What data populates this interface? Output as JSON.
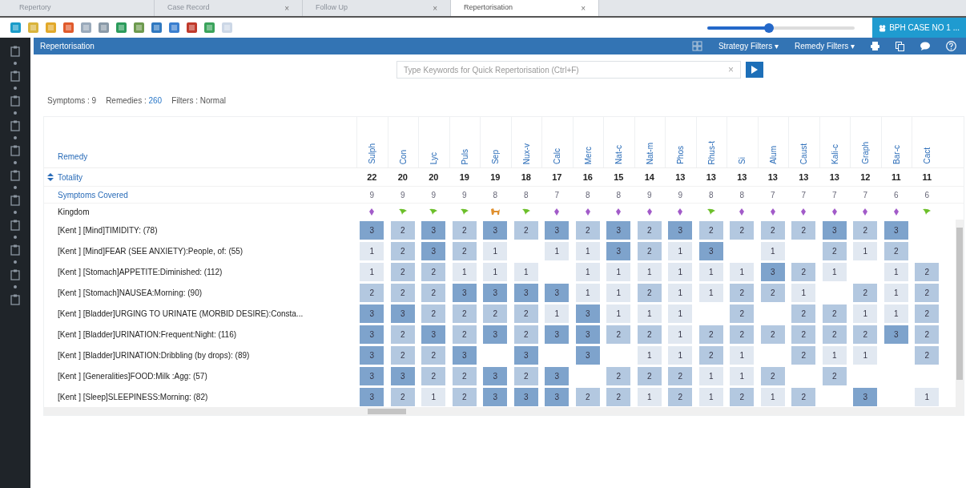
{
  "tabs": [
    {
      "label": "Repertory",
      "selected": false
    },
    {
      "label": "Case Record",
      "selected": false,
      "close": "×"
    },
    {
      "label": "Follow Up",
      "selected": false,
      "close": "×"
    },
    {
      "label": "Repertorisation",
      "selected": true,
      "close": "×"
    }
  ],
  "zoom_slider": {
    "level": 0.42
  },
  "case_button": {
    "label": "BPH CASE NO 1 ..."
  },
  "panel": {
    "title": "Repertorisation",
    "menus": [
      {
        "label": "Strategy Filters",
        "caret": "▾"
      },
      {
        "label": "Remedy Filters",
        "caret": "▾"
      }
    ]
  },
  "search": {
    "placeholder": "Type Keywords for Quick Repertorisation (Ctrl+F)",
    "clear": "×"
  },
  "stats": [
    {
      "label": "Symptoms :",
      "value": "9",
      "highlight": false
    },
    {
      "label": "Remedies :",
      "value": "260",
      "highlight": true
    },
    {
      "label": "Filters :",
      "value": "Normal",
      "highlight": false
    }
  ],
  "row_headers": {
    "remedy": "Remedy",
    "totality": "Totality",
    "covered": "Symptoms Covered",
    "kingdom": "Kingdom"
  },
  "remedies": [
    {
      "name": "Sulph",
      "totality": "22",
      "covered": "9",
      "kind": "mineral"
    },
    {
      "name": "Con",
      "totality": "20",
      "covered": "9",
      "kind": "plant"
    },
    {
      "name": "Lyc",
      "totality": "20",
      "covered": "9",
      "kind": "plant"
    },
    {
      "name": "Puls",
      "totality": "19",
      "covered": "9",
      "kind": "plant"
    },
    {
      "name": "Sep",
      "totality": "19",
      "covered": "8",
      "kind": "animal"
    },
    {
      "name": "Nux-v",
      "totality": "18",
      "covered": "8",
      "kind": "plant"
    },
    {
      "name": "Calc",
      "totality": "17",
      "covered": "7",
      "kind": "mineral"
    },
    {
      "name": "Merc",
      "totality": "16",
      "covered": "8",
      "kind": "mineral"
    },
    {
      "name": "Nat-c",
      "totality": "15",
      "covered": "8",
      "kind": "mineral"
    },
    {
      "name": "Nat-m",
      "totality": "14",
      "covered": "9",
      "kind": "mineral"
    },
    {
      "name": "Phos",
      "totality": "13",
      "covered": "9",
      "kind": "mineral"
    },
    {
      "name": "Rhus-t",
      "totality": "13",
      "covered": "8",
      "kind": "plant"
    },
    {
      "name": "Si",
      "totality": "13",
      "covered": "8",
      "kind": "mineral"
    },
    {
      "name": "Alum",
      "totality": "13",
      "covered": "7",
      "kind": "mineral"
    },
    {
      "name": "Caust",
      "totality": "13",
      "covered": "7",
      "kind": "mineral"
    },
    {
      "name": "Kali-c",
      "totality": "13",
      "covered": "7",
      "kind": "mineral"
    },
    {
      "name": "Graph",
      "totality": "12",
      "covered": "7",
      "kind": "mineral"
    },
    {
      "name": "Bar-c",
      "totality": "11",
      "covered": "6",
      "kind": "mineral"
    },
    {
      "name": "Cact",
      "totality": "11",
      "covered": "6",
      "kind": "plant"
    }
  ],
  "symptoms": [
    {
      "label": "[Kent ] [Mind]TIMIDITY: (78)",
      "cells": [
        {
          "grade": "3"
        },
        {
          "grade": "2"
        },
        {
          "grade": "3"
        },
        {
          "grade": "2"
        },
        {
          "grade": "3"
        },
        {
          "grade": "2"
        },
        {
          "grade": "3"
        },
        {
          "grade": "2"
        },
        {
          "grade": "3"
        },
        {
          "grade": "2"
        },
        {
          "grade": "3"
        },
        {
          "grade": "2"
        },
        {
          "grade": "2"
        },
        {
          "grade": "2"
        },
        {
          "grade": "2"
        },
        {
          "grade": "3"
        },
        {
          "grade": "2"
        },
        {
          "grade": "3"
        },
        {}
      ]
    },
    {
      "label": "[Kent ] [Mind]FEAR (SEE ANXIETY):People, of: (55)",
      "cells": [
        {
          "grade": "1"
        },
        {
          "grade": "2"
        },
        {
          "grade": "3"
        },
        {
          "grade": "2"
        },
        {
          "grade": "1"
        },
        {},
        {
          "grade": "1"
        },
        {
          "grade": "1"
        },
        {
          "grade": "3"
        },
        {
          "grade": "2"
        },
        {
          "grade": "1"
        },
        {
          "grade": "3"
        },
        {},
        {
          "grade": "1"
        },
        {},
        {
          "grade": "2"
        },
        {
          "grade": "1"
        },
        {
          "grade": "2"
        },
        {}
      ]
    },
    {
      "label": "[Kent ] [Stomach]APPETITE:Diminished: (112)",
      "cells": [
        {
          "grade": "1"
        },
        {
          "grade": "2"
        },
        {
          "grade": "2"
        },
        {
          "grade": "1"
        },
        {
          "grade": "1"
        },
        {
          "grade": "1"
        },
        {},
        {
          "grade": "1"
        },
        {
          "grade": "1"
        },
        {
          "grade": "1"
        },
        {
          "grade": "1"
        },
        {
          "grade": "1"
        },
        {
          "grade": "1"
        },
        {
          "grade": "3"
        },
        {
          "grade": "2"
        },
        {
          "grade": "1"
        },
        {},
        {
          "grade": "1"
        },
        {
          "grade": "2"
        }
      ]
    },
    {
      "label": "[Kent ] [Stomach]NAUSEA:Morning: (90)",
      "cells": [
        {
          "grade": "2"
        },
        {
          "grade": "2"
        },
        {
          "grade": "2"
        },
        {
          "grade": "3"
        },
        {
          "grade": "3"
        },
        {
          "grade": "3"
        },
        {
          "grade": "3"
        },
        {
          "grade": "1"
        },
        {
          "grade": "1"
        },
        {
          "grade": "2"
        },
        {
          "grade": "1"
        },
        {
          "grade": "1"
        },
        {
          "grade": "2"
        },
        {
          "grade": "2"
        },
        {
          "grade": "1"
        },
        {},
        {
          "grade": "2"
        },
        {
          "grade": "1"
        },
        {
          "grade": "2"
        }
      ]
    },
    {
      "label": "[Kent ] [Bladder]URGING TO URINATE (MORBID DESIRE):Consta...",
      "cells": [
        {
          "grade": "3"
        },
        {
          "grade": "3"
        },
        {
          "grade": "2"
        },
        {
          "grade": "2"
        },
        {
          "grade": "2"
        },
        {
          "grade": "2"
        },
        {
          "grade": "1"
        },
        {
          "grade": "3"
        },
        {
          "grade": "1"
        },
        {
          "grade": "1"
        },
        {
          "grade": "1"
        },
        {},
        {
          "grade": "2"
        },
        {},
        {
          "grade": "2"
        },
        {
          "grade": "2"
        },
        {
          "grade": "1"
        },
        {
          "grade": "1"
        },
        {
          "grade": "2"
        }
      ]
    },
    {
      "label": "[Kent ] [Bladder]URINATION:Frequent:Night: (116)",
      "cells": [
        {
          "grade": "3"
        },
        {
          "grade": "2"
        },
        {
          "grade": "3"
        },
        {
          "grade": "2"
        },
        {
          "grade": "3"
        },
        {
          "grade": "2"
        },
        {
          "grade": "3"
        },
        {
          "grade": "3"
        },
        {
          "grade": "2"
        },
        {
          "grade": "2"
        },
        {
          "grade": "1"
        },
        {
          "grade": "2"
        },
        {
          "grade": "2"
        },
        {
          "grade": "2"
        },
        {
          "grade": "2"
        },
        {
          "grade": "2"
        },
        {
          "grade": "2"
        },
        {
          "grade": "3"
        },
        {
          "grade": "2"
        }
      ]
    },
    {
      "label": "[Kent ] [Bladder]URINATION:Dribbling (by drops): (89)",
      "cells": [
        {
          "grade": "3"
        },
        {
          "grade": "2"
        },
        {
          "grade": "2"
        },
        {
          "grade": "3"
        },
        {},
        {
          "grade": "3"
        },
        {},
        {
          "grade": "3"
        },
        {},
        {
          "grade": "1"
        },
        {
          "grade": "1"
        },
        {
          "grade": "2"
        },
        {
          "grade": "1"
        },
        {},
        {
          "grade": "2"
        },
        {
          "grade": "1"
        },
        {
          "grade": "1"
        },
        {},
        {
          "grade": "2"
        }
      ]
    },
    {
      "label": "[Kent ] [Generalities]FOOD:Milk :Agg: (57)",
      "cells": [
        {
          "grade": "3"
        },
        {
          "grade": "3"
        },
        {
          "grade": "2"
        },
        {
          "grade": "2"
        },
        {
          "grade": "3"
        },
        {
          "grade": "2"
        },
        {
          "grade": "3"
        },
        {},
        {
          "grade": "2"
        },
        {
          "grade": "2"
        },
        {
          "grade": "2"
        },
        {
          "grade": "1"
        },
        {
          "grade": "1"
        },
        {
          "grade": "2"
        },
        {},
        {
          "grade": "2"
        },
        {},
        {},
        {}
      ]
    },
    {
      "label": "[Kent ] [Sleep]SLEEPINESS:Morning: (82)",
      "cells": [
        {
          "grade": "3"
        },
        {
          "grade": "2"
        },
        {
          "grade": "1"
        },
        {
          "grade": "2"
        },
        {
          "grade": "3"
        },
        {
          "grade": "3"
        },
        {
          "grade": "3"
        },
        {
          "grade": "2"
        },
        {
          "grade": "2"
        },
        {
          "grade": "1"
        },
        {
          "grade": "2"
        },
        {
          "grade": "1"
        },
        {
          "grade": "2"
        },
        {
          "grade": "1"
        },
        {
          "grade": "2"
        },
        {},
        {
          "grade": "3"
        },
        {},
        {
          "grade": "1"
        }
      ]
    }
  ]
}
